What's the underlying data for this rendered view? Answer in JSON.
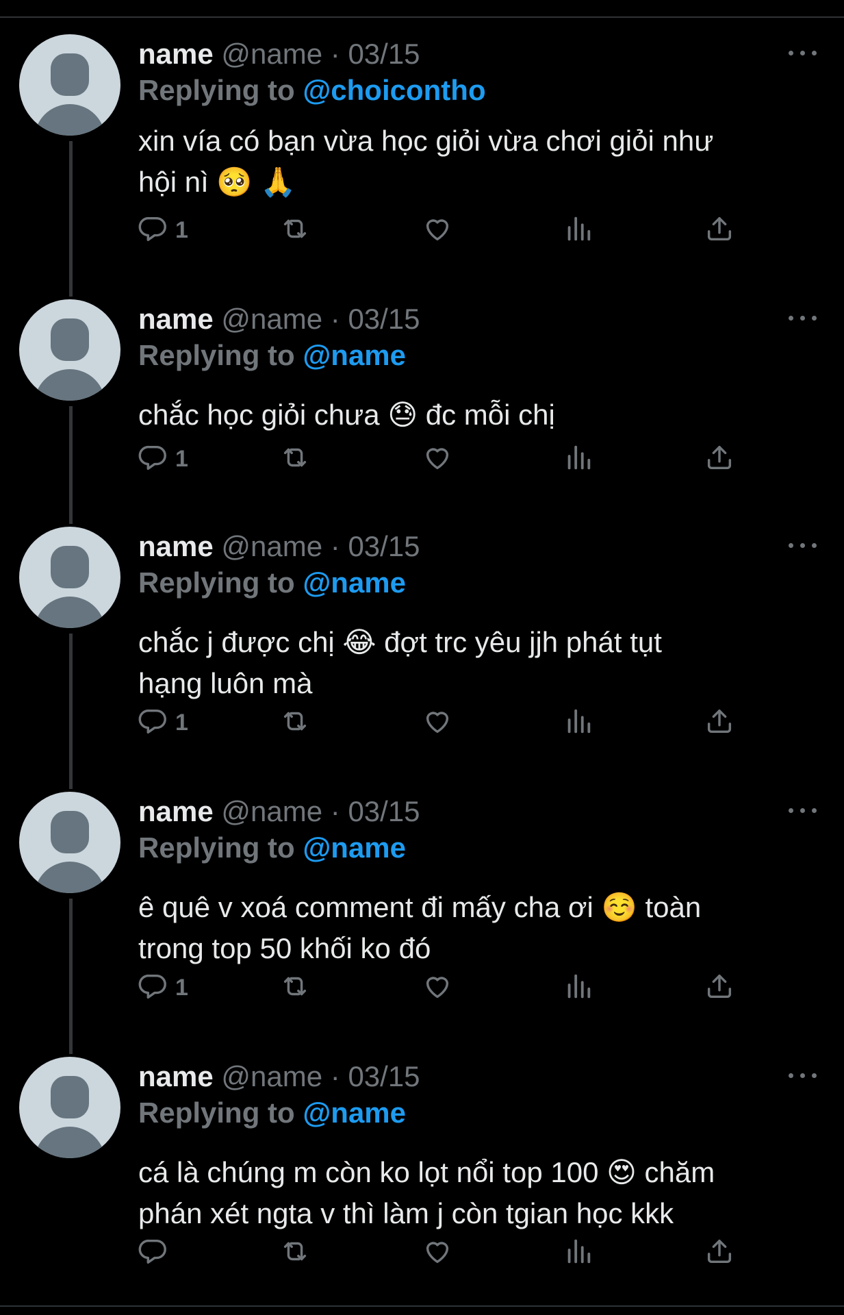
{
  "tweets": [
    {
      "name": "name",
      "handle": "@name",
      "sep": "·",
      "date": "03/15",
      "reply_prefix": "Replying to",
      "reply_to": "@choicontho",
      "text_lines": [
        "xin vía có bạn vừa học giỏi vừa chơi giỏi như",
        "hội nì 🥺 🙏"
      ],
      "reply_count": "1"
    },
    {
      "name": "name",
      "handle": "@name",
      "sep": "·",
      "date": "03/15",
      "reply_prefix": "Replying to",
      "reply_to": "@name",
      "text_lines": [
        "chắc học giỏi chưa 😓  đc mỗi chị"
      ],
      "reply_count": "1"
    },
    {
      "name": "name",
      "handle": "@name",
      "sep": "·",
      "date": "03/15",
      "reply_prefix": "Replying to",
      "reply_to": "@name",
      "text_lines": [
        "chắc j được chị 😂  đợt trc yêu jjh phát tụt",
        "hạng luôn mà"
      ],
      "reply_count": "1"
    },
    {
      "name": "name",
      "handle": "@name",
      "sep": "·",
      "date": "03/15",
      "reply_prefix": "Replying to",
      "reply_to": "@name",
      "text_lines": [
        "ê quê v xoá comment đi mấy cha ơi ☺️  toàn",
        "trong top 50 khối ko đó"
      ],
      "reply_count": "1"
    },
    {
      "name": "name",
      "handle": "@name",
      "sep": "·",
      "date": "03/15",
      "reply_prefix": "Replying to",
      "reply_to": "@name",
      "text_lines": [
        "cá là chúng m còn ko lọt nổi top 100 😍  chăm",
        "phán xét ngta v thì làm j còn tgian học kkk"
      ],
      "reply_count": ""
    }
  ],
  "icons": {
    "reply": "reply-icon",
    "retweet": "retweet-icon",
    "like": "heart-icon",
    "views": "views-icon",
    "share": "share-icon",
    "more": "more-icon"
  },
  "colors": {
    "background": "#000000",
    "text": "#e7e9ea",
    "muted": "#71767b",
    "accent": "#1d9bf0"
  }
}
